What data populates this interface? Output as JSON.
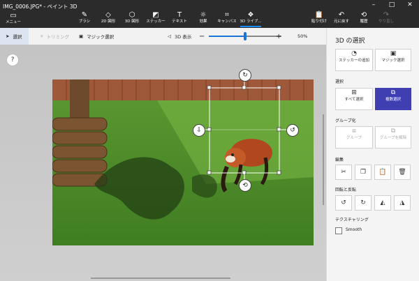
{
  "window": {
    "title": "IMG_0006.JPG* - ペイント 3D"
  },
  "menu": {
    "label": "メニュー"
  },
  "tools": [
    {
      "label": "ブラシ",
      "icon": "brush-icon"
    },
    {
      "label": "2D 図形",
      "icon": "2d-shapes-icon"
    },
    {
      "label": "3D 図形",
      "icon": "3d-shapes-icon"
    },
    {
      "label": "ステッカー",
      "icon": "sticker-icon"
    },
    {
      "label": "テキスト",
      "icon": "text-icon"
    },
    {
      "label": "効果",
      "icon": "effects-icon"
    },
    {
      "label": "キャンバス",
      "icon": "canvas-icon"
    },
    {
      "label": "3D ライブ...",
      "icon": "3d-library-icon"
    }
  ],
  "right_tools": [
    {
      "label": "貼り付け",
      "icon": "paste-icon"
    },
    {
      "label": "元に戻す",
      "icon": "undo-icon"
    },
    {
      "label": "履歴",
      "icon": "history-icon"
    },
    {
      "label": "やり直し",
      "icon": "redo-icon"
    }
  ],
  "toolbar": {
    "select": "選択",
    "crop": "トリミング",
    "magic_select": "マジック選択",
    "view3d": "3D 表示",
    "zoom": "50%",
    "zoom_minus": "−",
    "zoom_plus": "+",
    "zoom_level": 0.5
  },
  "help": "?",
  "panel": {
    "title": "3D の選択",
    "add_sticker": "ステッカーの追加",
    "magic_select": "マジック選択",
    "selection_label": "選択",
    "select_all": "すべて選択",
    "multi_select": "複数選択",
    "group_label": "グループ化",
    "group": "グループ",
    "ungroup": "グループを解除",
    "edit_label": "編集",
    "rotate_flip_label": "回転と反転",
    "texturing_label": "テクスチャリング",
    "smooth": "Smooth"
  },
  "colors": {
    "accent": "#3f3fb2",
    "titlebar": "#2b2b2b",
    "slider": "#1a73d9"
  }
}
